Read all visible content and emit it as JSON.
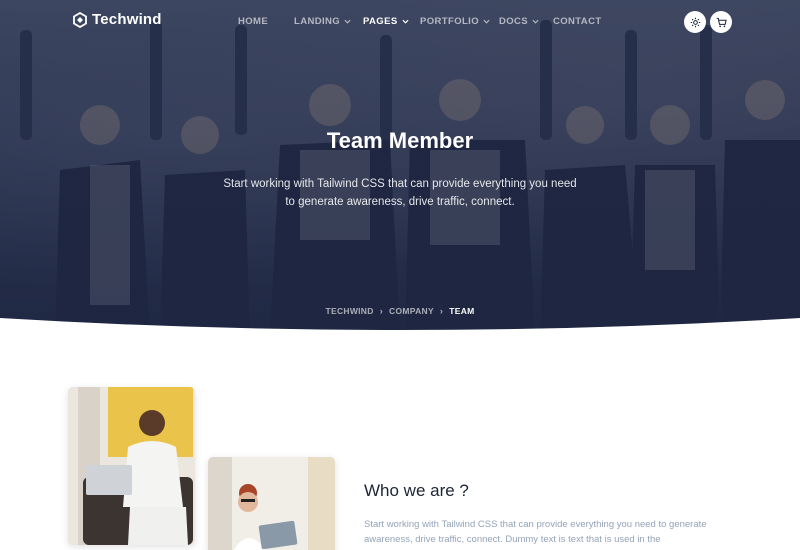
{
  "brand": {
    "name": "Techwind"
  },
  "nav": {
    "items": [
      {
        "label": "HOME",
        "dropdown": false,
        "active": false
      },
      {
        "label": "LANDING",
        "dropdown": true,
        "active": false
      },
      {
        "label": "PAGES",
        "dropdown": true,
        "active": true
      },
      {
        "label": "PORTFOLIO",
        "dropdown": true,
        "active": false
      },
      {
        "label": "DOCS",
        "dropdown": true,
        "active": false
      },
      {
        "label": "CONTACT",
        "dropdown": false,
        "active": false
      }
    ],
    "actions": [
      {
        "icon": "gear-icon"
      },
      {
        "icon": "cart-icon"
      }
    ]
  },
  "hero": {
    "title": "Team Member",
    "subtitle": "Start working with Tailwind CSS that can provide everything you need to generate awareness, drive traffic, connect.",
    "breadcrumb": [
      "TECHWIND",
      "COMPANY",
      "TEAM"
    ]
  },
  "about": {
    "title": "Who we are ?",
    "text": "Start working with Tailwind CSS that can provide everything you need to generate awareness, drive traffic, connect. Dummy text is text that is used in the"
  },
  "colors": {
    "heroOverlay": "#1c2646",
    "headingText": "#1c2536",
    "mutedText": "#94a3b8",
    "white": "#ffffff"
  }
}
